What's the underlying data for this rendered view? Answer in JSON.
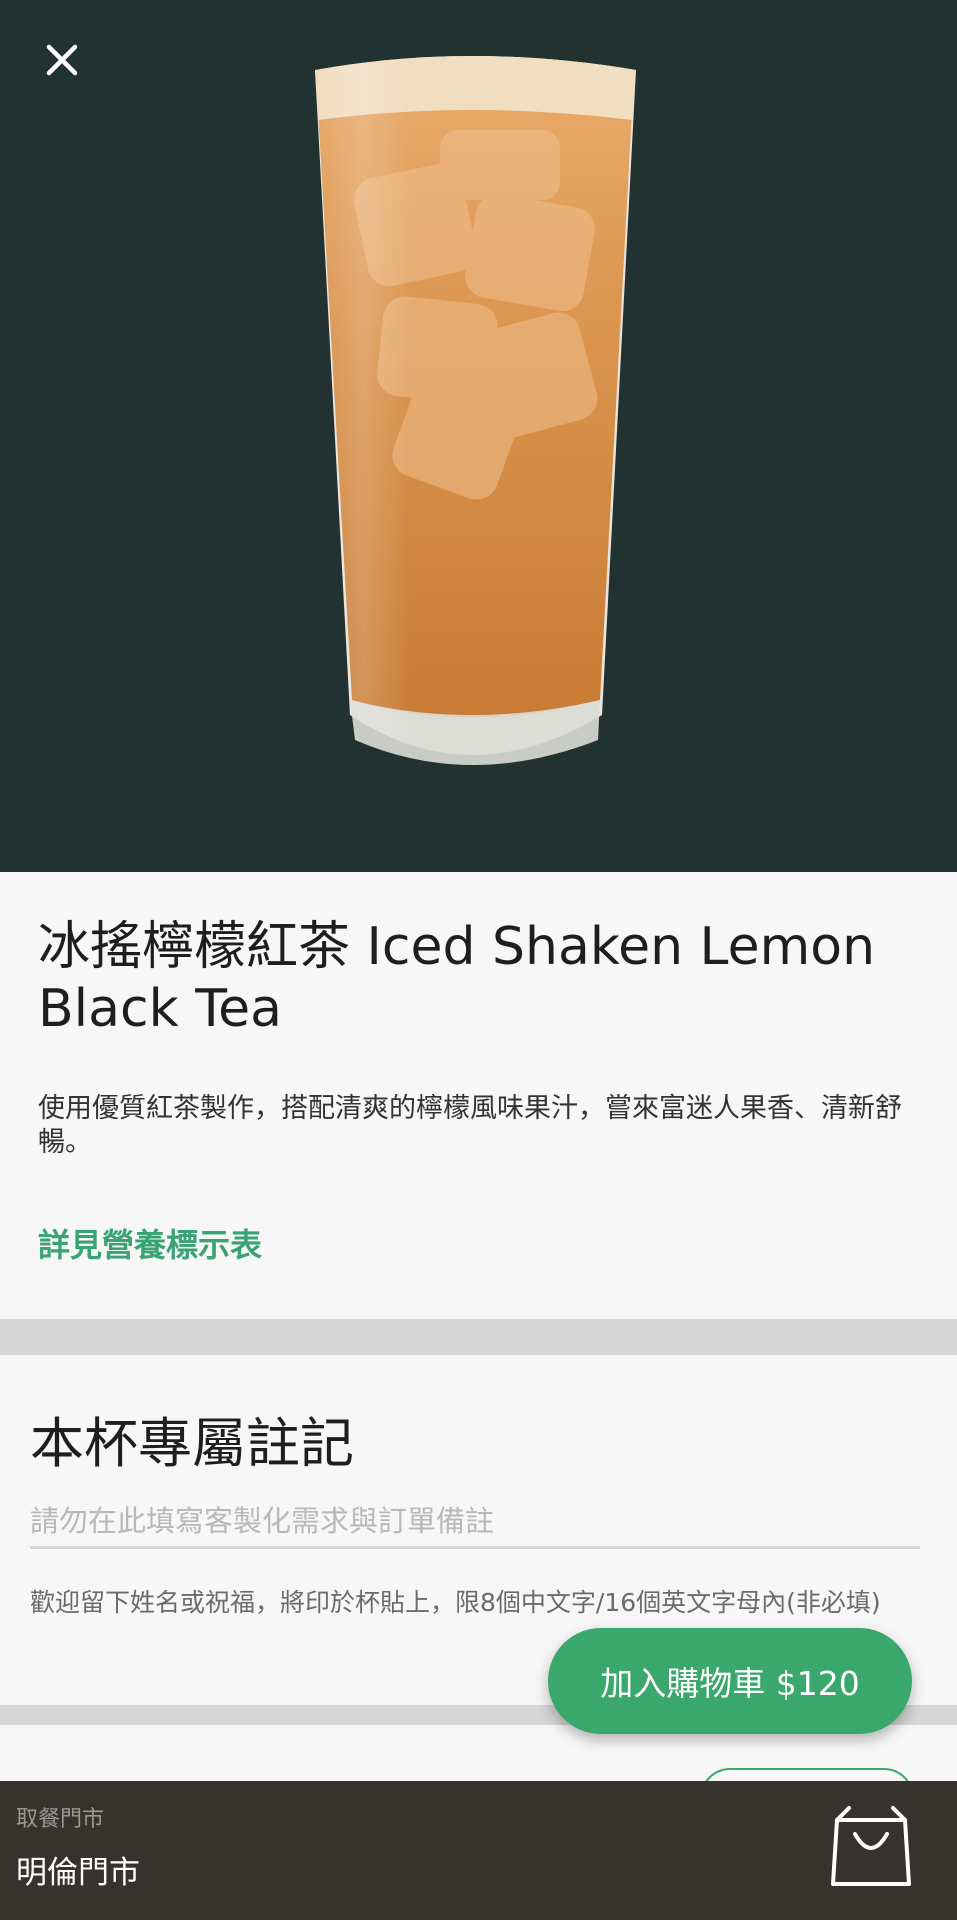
{
  "header": {
    "close_icon": "close-icon"
  },
  "hero": {
    "image": "iced-lemon-black-tea-photo",
    "background_color": "#223230"
  },
  "product": {
    "title": "冰搖檸檬紅茶 Iced Shaken Lemon Black Tea",
    "description": "使用優質紅茶製作，搭配清爽的檸檬風味果汁，嘗來富迷人果香、清新舒暢。",
    "nutrition_link": "詳見營養標示表"
  },
  "note": {
    "title": "本杯專屬註記",
    "placeholder": "請勿在此填寫客製化需求與訂單備註",
    "value": "",
    "hint": "歡迎留下姓名或祝福，將印於杯貼上，限8個中文字/16個英文字母內(非必填)"
  },
  "cart_button": {
    "label": "加入購物車 $120",
    "color": "#3aa76d"
  },
  "bottom_bar": {
    "store_label": "取餐門市",
    "store_name": "明倫門市",
    "bag_icon": "shopping-bag-icon"
  }
}
